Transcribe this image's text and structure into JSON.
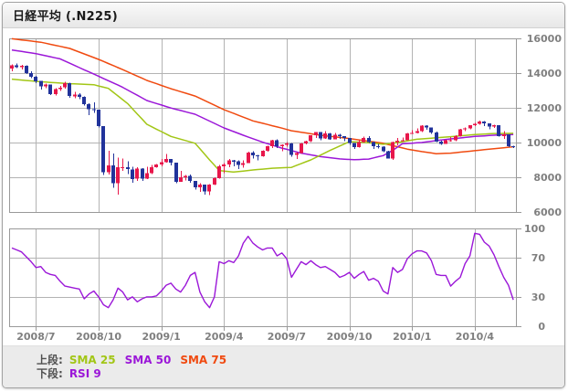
{
  "window": {
    "title": "日経平均 (.N225)"
  },
  "legend": {
    "upper_label": "上段:",
    "lower_label": "下段:",
    "sma25": "SMA 25",
    "sma50": "SMA 50",
    "sma75": "SMA 75",
    "rsi": "RSI 9"
  },
  "colors": {
    "up_candle": "#e8174b",
    "down_candle": "#21339b",
    "sma25": "#a2c616",
    "sma50": "#9b17d8",
    "sma75": "#f04a10",
    "rsi": "#9b17d8",
    "grid": "#b3b3b3",
    "panel_border": "#999999",
    "axis_text": "#7f7f7f",
    "legend_bg": "#ebebeb",
    "chart_bg": "#ffffff"
  },
  "chart_data": {
    "type": "candlestick",
    "title": "日経平均 (.N225)",
    "interval": "weekly",
    "panels": [
      {
        "name": "price",
        "indicators": [
          "SMA 25",
          "SMA 50",
          "SMA 75"
        ]
      },
      {
        "name": "oscillator",
        "indicators": [
          "RSI 9"
        ]
      }
    ],
    "price_axis": {
      "max": 16000,
      "min": 6000,
      "ticks": [
        16000,
        14000,
        12000,
        10000,
        8000,
        6000
      ]
    },
    "rsi_axis": {
      "max": 100,
      "min": 0,
      "ticks": [
        100,
        70,
        30,
        0
      ],
      "gridlines": [
        70,
        30
      ]
    },
    "x_ticks": [
      {
        "label": "2008/7",
        "index": 5
      },
      {
        "label": "2008/10",
        "index": 18
      },
      {
        "label": "2009/1",
        "index": 31
      },
      {
        "label": "2009/4",
        "index": 44
      },
      {
        "label": "2009/7",
        "index": 57
      },
      {
        "label": "2009/10",
        "index": 70
      },
      {
        "label": "2010/1",
        "index": 83
      },
      {
        "label": "2010/4",
        "index": 96
      }
    ],
    "candles_ohlc": [
      [
        14250,
        14500,
        14100,
        14440
      ],
      [
        14440,
        14560,
        14280,
        14330
      ],
      [
        14330,
        14480,
        14220,
        14430
      ],
      [
        14430,
        14440,
        13950,
        14010
      ],
      [
        14010,
        14110,
        13700,
        13790
      ],
      [
        13790,
        13830,
        13430,
        13540
      ],
      [
        13540,
        13560,
        13060,
        13240
      ],
      [
        13240,
        13390,
        13130,
        13340
      ],
      [
        13340,
        13350,
        12750,
        12800
      ],
      [
        12800,
        13130,
        12700,
        13090
      ],
      [
        13090,
        13260,
        12980,
        13170
      ],
      [
        13170,
        13490,
        13110,
        13430
      ],
      [
        13430,
        13440,
        12590,
        12670
      ],
      [
        12670,
        12920,
        12550,
        12770
      ],
      [
        12770,
        12830,
        12500,
        12620
      ],
      [
        12620,
        12670,
        12130,
        12210
      ],
      [
        12210,
        12260,
        11580,
        11920
      ],
      [
        11920,
        12310,
        11720,
        11890
      ],
      [
        11890,
        11900,
        10870,
        10940
      ],
      [
        10940,
        10950,
        8120,
        8280
      ],
      [
        8280,
        9520,
        8170,
        8690
      ],
      [
        8690,
        9380,
        7390,
        7650
      ],
      [
        7650,
        9120,
        6990,
        8580
      ],
      [
        8580,
        9090,
        8380,
        8583
      ],
      [
        8583,
        8910,
        8180,
        8460
      ],
      [
        8460,
        8610,
        7680,
        7910
      ],
      [
        7910,
        8580,
        7800,
        8510
      ],
      [
        8510,
        8520,
        7780,
        7917
      ],
      [
        7917,
        8610,
        7890,
        8235
      ],
      [
        8235,
        8710,
        8180,
        8588
      ],
      [
        8588,
        8760,
        8540,
        8740
      ],
      [
        8740,
        9060,
        8640,
        8860
      ],
      [
        8860,
        9330,
        8840,
        9043
      ],
      [
        9043,
        9060,
        8690,
        8836
      ],
      [
        8836,
        8840,
        7660,
        7745
      ],
      [
        7745,
        8370,
        7730,
        7994
      ],
      [
        7994,
        8130,
        7810,
        8076
      ],
      [
        8076,
        8170,
        7680,
        7779
      ],
      [
        7779,
        7790,
        7290,
        7416
      ],
      [
        7416,
        7650,
        7150,
        7568
      ],
      [
        7568,
        7570,
        7010,
        7173
      ],
      [
        7173,
        7610,
        6980,
        7569
      ],
      [
        7569,
        8010,
        7550,
        7946
      ],
      [
        7946,
        8710,
        7930,
        8626
      ],
      [
        8626,
        8810,
        8240,
        8750
      ],
      [
        8750,
        9050,
        8590,
        8964
      ],
      [
        8964,
        9010,
        8640,
        8908
      ],
      [
        8908,
        8970,
        8480,
        8707
      ],
      [
        8707,
        8980,
        8560,
        8828
      ],
      [
        8828,
        9480,
        8820,
        9432
      ],
      [
        9432,
        9510,
        9090,
        9265
      ],
      [
        9265,
        9280,
        8980,
        9225
      ],
      [
        9225,
        9540,
        9180,
        9523
      ],
      [
        9523,
        9810,
        9480,
        9787
      ],
      [
        9787,
        10150,
        9690,
        10136
      ],
      [
        10136,
        10180,
        9690,
        9786
      ],
      [
        9786,
        9900,
        9490,
        9877
      ],
      [
        9877,
        10020,
        9770,
        9958
      ],
      [
        9958,
        9970,
        9190,
        9287
      ],
      [
        9287,
        9460,
        9040,
        9395
      ],
      [
        9395,
        9970,
        9370,
        9944
      ],
      [
        9944,
        10110,
        9890,
        10088
      ],
      [
        10088,
        10430,
        10030,
        10412
      ],
      [
        10412,
        10610,
        10260,
        10597
      ],
      [
        10597,
        10610,
        10130,
        10238
      ],
      [
        10238,
        10650,
        10220,
        10534
      ],
      [
        10534,
        10560,
        10170,
        10187
      ],
      [
        10187,
        10550,
        10180,
        10444
      ],
      [
        10444,
        10490,
        10200,
        10371
      ],
      [
        10371,
        10380,
        10070,
        10265
      ],
      [
        10265,
        10270,
        9880,
        9979
      ],
      [
        9979,
        9980,
        9620,
        9732
      ],
      [
        9732,
        10130,
        9710,
        10016
      ],
      [
        10016,
        10350,
        10000,
        10257
      ],
      [
        10257,
        10370,
        9980,
        10035
      ],
      [
        10035,
        10040,
        9630,
        9790
      ],
      [
        9790,
        9930,
        9670,
        9770
      ],
      [
        9770,
        9790,
        9440,
        9498
      ],
      [
        9498,
        9520,
        9070,
        9081
      ],
      [
        9081,
        10040,
        9000,
        10022
      ],
      [
        10022,
        10260,
        9850,
        10108
      ],
      [
        10108,
        10290,
        10040,
        10142
      ],
      [
        10142,
        10550,
        10130,
        10536
      ],
      [
        10536,
        10710,
        10490,
        10546
      ],
      [
        10546,
        10810,
        10530,
        10654
      ],
      [
        10654,
        10990,
        10610,
        10982
      ],
      [
        10982,
        10990,
        10730,
        10868
      ],
      [
        10868,
        10870,
        10510,
        10590
      ],
      [
        10590,
        10620,
        10020,
        10057
      ],
      [
        10057,
        10100,
        9860,
        9932
      ],
      [
        9932,
        10170,
        9910,
        10123
      ],
      [
        10123,
        10310,
        10050,
        10126
      ],
      [
        10126,
        10410,
        10080,
        10369
      ],
      [
        10369,
        10780,
        10350,
        10751
      ],
      [
        10751,
        10860,
        10650,
        10824
      ],
      [
        10824,
        11010,
        10760,
        10996
      ],
      [
        10996,
        11140,
        10950,
        11089
      ],
      [
        11089,
        11260,
        11020,
        11204
      ],
      [
        11204,
        11230,
        10950,
        11102
      ],
      [
        11102,
        11110,
        10770,
        10914
      ],
      [
        10914,
        11020,
        10850,
        11008
      ],
      [
        11008,
        11010,
        10350,
        10364
      ],
      [
        10364,
        10650,
        10210,
        10462
      ],
      [
        10462,
        10470,
        9740,
        9785
      ],
      [
        9785,
        9820,
        9690,
        9768
      ]
    ],
    "series": [
      {
        "name": "SMA 25",
        "color_key": "sma25",
        "values": [
          13650,
          13625,
          13600,
          13575,
          13550,
          13525,
          13500,
          13482,
          13463,
          13445,
          13427,
          13408,
          13390,
          13378,
          13366,
          13354,
          13342,
          13330,
          13260,
          13190,
          13120,
          12902,
          12685,
          12468,
          12250,
          11950,
          11650,
          11350,
          11050,
          10910,
          10770,
          10630,
          10490,
          10350,
          10272,
          10194,
          10116,
          10038,
          9960,
          9640,
          9320,
          9000,
          8695,
          8390,
          8360,
          8330,
          8300,
          8330,
          8360,
          8390,
          8420,
          8445,
          8470,
          8495,
          8520,
          8533,
          8545,
          8558,
          8570,
          8678,
          8785,
          8893,
          9000,
          9138,
          9275,
          9413,
          9550,
          9675,
          9800,
          9925,
          10050,
          10035,
          10020,
          10005,
          9990,
          9960,
          9930,
          9900,
          9933,
          9967,
          10000,
          10048,
          10095,
          10143,
          10190,
          10211,
          10232,
          10253,
          10273,
          10294,
          10315,
          10339,
          10363,
          10388,
          10412,
          10436,
          10460,
          10475,
          10490,
          10505,
          10520,
          10523,
          10525,
          10528,
          10530
        ]
      },
      {
        "name": "SMA 50",
        "color_key": "sma50",
        "values": [
          15330,
          15288,
          15246,
          15204,
          15162,
          15120,
          15060,
          15000,
          14940,
          14880,
          14820,
          14693,
          14567,
          14440,
          14316,
          14192,
          14068,
          13944,
          13820,
          13692,
          13564,
          13436,
          13308,
          13180,
          13028,
          12876,
          12724,
          12572,
          12420,
          12334,
          12248,
          12162,
          12076,
          11990,
          11918,
          11846,
          11774,
          11702,
          11630,
          11498,
          11367,
          11235,
          11103,
          10972,
          10840,
          10735,
          10630,
          10525,
          10420,
          10320,
          10220,
          10120,
          10020,
          9935,
          9850,
          9765,
          9680,
          9608,
          9535,
          9463,
          9390,
          9340,
          9290,
          9240,
          9190,
          9158,
          9125,
          9093,
          9060,
          9043,
          9027,
          9010,
          9023,
          9037,
          9050,
          9117,
          9183,
          9250,
          9400,
          9550,
          9740,
          9930,
          9948,
          9965,
          9983,
          10000,
          10036,
          10072,
          10108,
          10144,
          10180,
          10208,
          10237,
          10265,
          10293,
          10322,
          10350,
          10368,
          10386,
          10404,
          10422,
          10440,
          10447,
          10453,
          10460
        ]
      },
      {
        "name": "SMA 75",
        "color_key": "sma75",
        "values": [
          15980,
          15947,
          15913,
          15880,
          15847,
          15813,
          15780,
          15720,
          15660,
          15600,
          15540,
          15480,
          15420,
          15315,
          15210,
          15105,
          15000,
          14895,
          14790,
          14672,
          14554,
          14436,
          14318,
          14200,
          14076,
          13952,
          13828,
          13704,
          13580,
          13484,
          13388,
          13292,
          13196,
          13100,
          13016,
          12932,
          12848,
          12764,
          12680,
          12548,
          12417,
          12285,
          12153,
          12022,
          11890,
          11783,
          11677,
          11570,
          11463,
          11357,
          11250,
          11180,
          11110,
          11040,
          10970,
          10900,
          10830,
          10755,
          10680,
          10637,
          10593,
          10550,
          10507,
          10463,
          10420,
          10388,
          10357,
          10325,
          10293,
          10262,
          10230,
          10191,
          10153,
          10114,
          10076,
          10037,
          9999,
          9960,
          9892,
          9824,
          9756,
          9688,
          9620,
          9573,
          9527,
          9480,
          9440,
          9400,
          9360,
          9370,
          9380,
          9390,
          9418,
          9446,
          9474,
          9502,
          9530,
          9558,
          9587,
          9615,
          9643,
          9672,
          9700,
          9730,
          9760
        ]
      }
    ],
    "rsi9": {
      "name": "RSI 9",
      "color_key": "rsi",
      "values": [
        80,
        78,
        76,
        71,
        66,
        60,
        61,
        55,
        53,
        52,
        46,
        41,
        40,
        39,
        38,
        28,
        33,
        36,
        30,
        22,
        19,
        27,
        39,
        35,
        27,
        30,
        25,
        28,
        30,
        30,
        31,
        36,
        42,
        44,
        38,
        35,
        42,
        52,
        55,
        35,
        25,
        19,
        30,
        66,
        64,
        67,
        65,
        72,
        85,
        92,
        85,
        81,
        78,
        80,
        80,
        72,
        75,
        69,
        50,
        58,
        66,
        63,
        67,
        63,
        60,
        61,
        58,
        55,
        50,
        52,
        55,
        49,
        53,
        56,
        47,
        49,
        46,
        36,
        33,
        60,
        55,
        58,
        69,
        74,
        77,
        77,
        75,
        67,
        53,
        52,
        52,
        41,
        46,
        50,
        64,
        72,
        95,
        94,
        86,
        82,
        73,
        61,
        50,
        42,
        27
      ]
    }
  }
}
